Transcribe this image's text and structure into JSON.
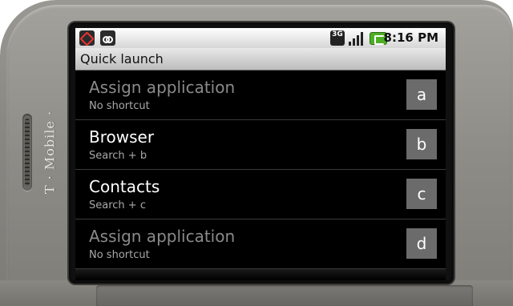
{
  "device": {
    "brand": "T · Mobile ·"
  },
  "status_bar": {
    "icons": [
      "missed-call-icon",
      "voicemail-icon",
      "3g-data-icon",
      "signal-strength-icon",
      "battery-charging-icon"
    ],
    "network_label": "3G",
    "time": "8:16 PM"
  },
  "title_bar": {
    "title": "Quick launch"
  },
  "shortcuts": [
    {
      "title": "Assign application",
      "subtitle": "No shortcut",
      "key": "a",
      "assigned": false
    },
    {
      "title": "Browser",
      "subtitle": "Search + b",
      "key": "b",
      "assigned": true
    },
    {
      "title": "Contacts",
      "subtitle": "Search + c",
      "key": "c",
      "assigned": true
    },
    {
      "title": "Assign application",
      "subtitle": "No shortcut",
      "key": "d",
      "assigned": false
    }
  ],
  "colors": {
    "battery": "#4caf25",
    "key_badge": "#6b6b6b",
    "disabled_text": "#8a8a8a"
  }
}
